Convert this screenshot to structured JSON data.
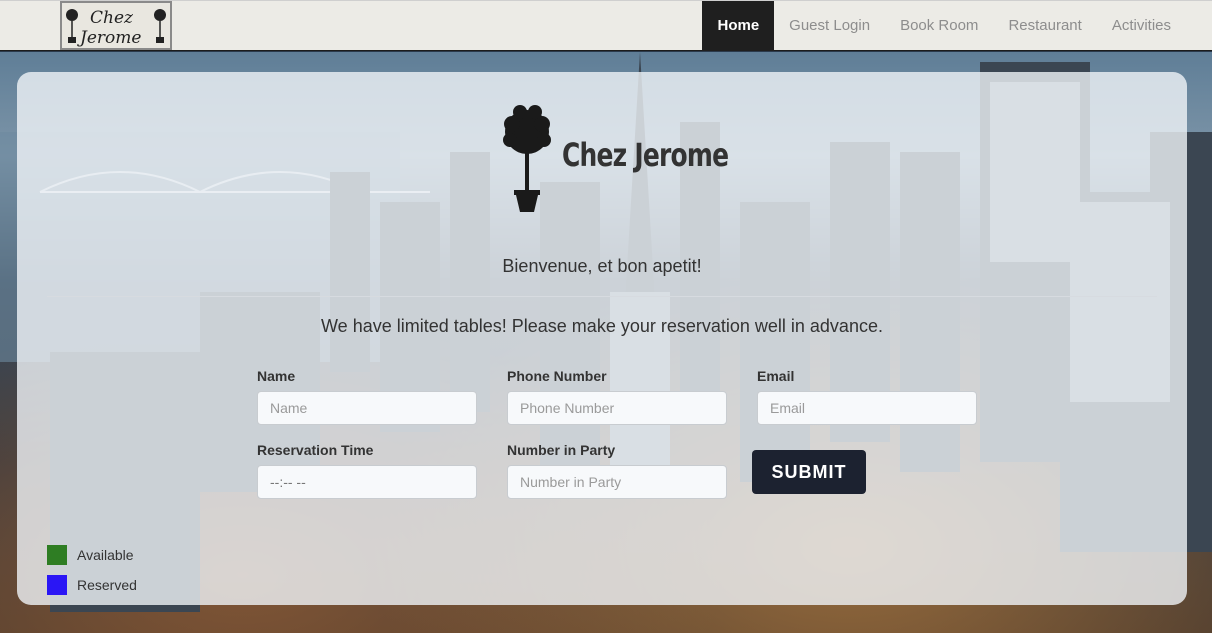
{
  "nav": {
    "brand_text": "Chez Jerome",
    "items": [
      {
        "label": "Home",
        "active": true
      },
      {
        "label": "Guest Login",
        "active": false
      },
      {
        "label": "Book Room",
        "active": false
      },
      {
        "label": "Restaurant",
        "active": false
      },
      {
        "label": "Activities",
        "active": false
      }
    ]
  },
  "hero": {
    "title": "Chez Jerome",
    "welcome": "Bienvenue, et bon apetit!",
    "notice": "We have limited tables! Please make your reservation well in advance."
  },
  "form": {
    "name": {
      "label": "Name",
      "placeholder": "Name"
    },
    "phone": {
      "label": "Phone Number",
      "placeholder": "Phone Number"
    },
    "email": {
      "label": "Email",
      "placeholder": "Email"
    },
    "time": {
      "label": "Reservation Time",
      "value": "--:-- --"
    },
    "party": {
      "label": "Number in Party",
      "placeholder": "Number in Party"
    },
    "submit_label": "SUBMIT"
  },
  "legend": [
    {
      "label": "Available",
      "color": "#2e7d23"
    },
    {
      "label": "Reserved",
      "color": "#2a16f5"
    }
  ],
  "colors": {
    "nav_active_bg": "#1f1f1f",
    "submit_bg": "#1c2230"
  }
}
